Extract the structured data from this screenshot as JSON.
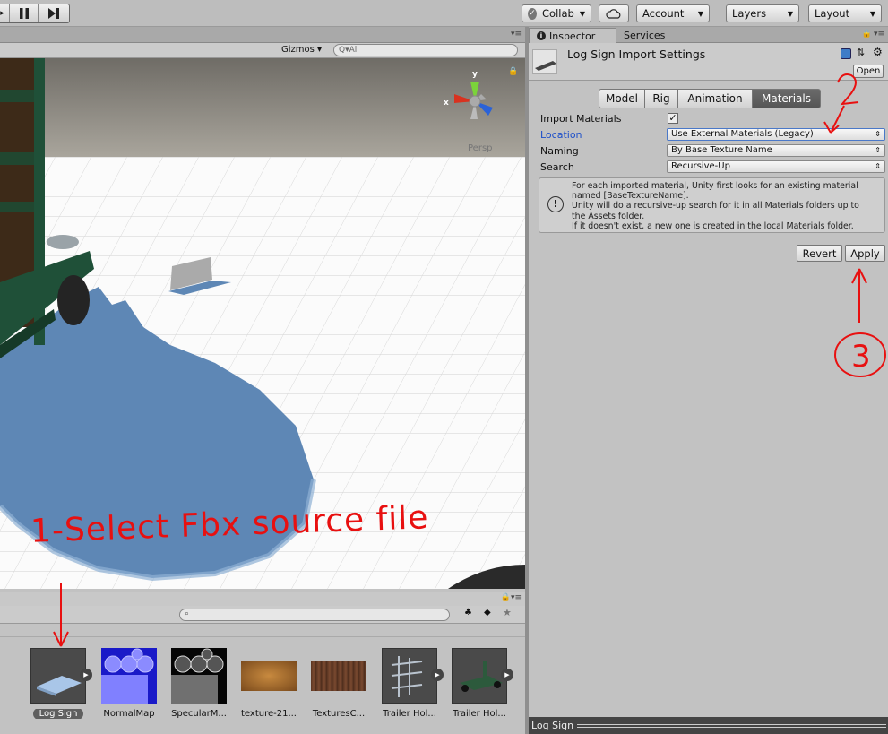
{
  "toolbar": {
    "collab": "Collab",
    "account": "Account",
    "layers": "Layers",
    "layout": "Layout"
  },
  "scene": {
    "gizmos": "Gizmos",
    "search_placeholder": "Q▾All",
    "persp": "Persp",
    "axis_x": "x",
    "axis_y": "y"
  },
  "project": {
    "assets": [
      {
        "label": "Log Sign",
        "selected": true
      },
      {
        "label": "NormalMap"
      },
      {
        "label": "SpecularM..."
      },
      {
        "label": "texture-21..."
      },
      {
        "label": "TexturesC..."
      },
      {
        "label": "Trailer Hol..."
      },
      {
        "label": "Trailer Hol..."
      }
    ]
  },
  "inspector": {
    "tab_inspector": "Inspector",
    "tab_services": "Services",
    "title": "Log Sign Import Settings",
    "open_button": "Open",
    "tabs": [
      "Model",
      "Rig",
      "Animation",
      "Materials"
    ],
    "active_tab": "Materials",
    "props": {
      "import_materials": "Import Materials",
      "location": "Location",
      "location_value": "Use External Materials (Legacy)",
      "naming": "Naming",
      "naming_value": "By Base Texture Name",
      "search": "Search",
      "search_value": "Recursive-Up"
    },
    "help_lines": [
      "For each imported material, Unity first looks for an existing material",
      "named [BaseTextureName].",
      "Unity will do a recursive-up search for it in all Materials folders up to",
      "the Assets folder.",
      "If it doesn't exist, a new one is created in the local Materials folder."
    ],
    "revert": "Revert",
    "apply": "Apply",
    "footer": "Log Sign"
  },
  "annotations": {
    "step1": "1-Select Fbx source file",
    "step2": "2",
    "step3": "3"
  },
  "colors": {
    "annotation": "#e81010",
    "location_label": "#1d4fc9"
  }
}
